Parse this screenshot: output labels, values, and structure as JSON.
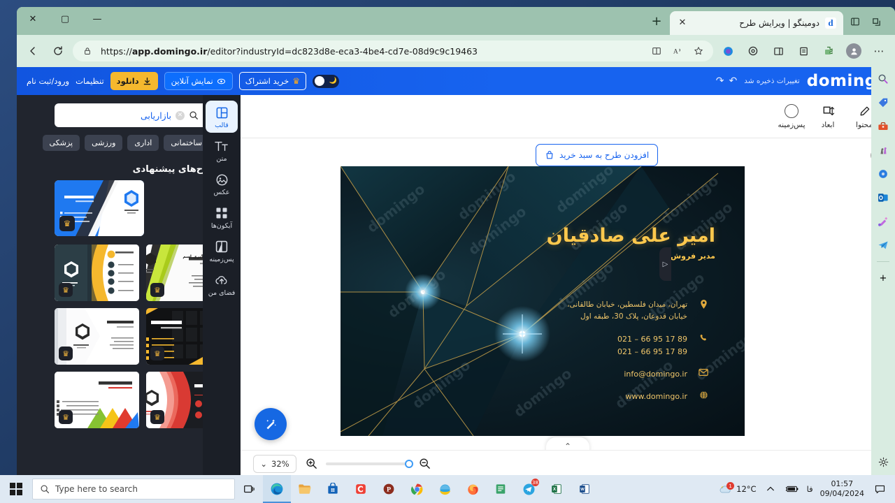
{
  "browser": {
    "tab": {
      "title": "دومینگو | ویرایش طرح",
      "favicon_letter": "d"
    },
    "new_tab_label": "+",
    "url_prefix": "https://",
    "url_domain": "app.domingo.ir",
    "url_path": "/editor?industryId=dc823d8e-eca3-4be4-cd7e-08d9c9c19463",
    "window_controls": {
      "minimize": "—",
      "maximize": "▢",
      "close": "✕"
    }
  },
  "app_header": {
    "logo": "domingo",
    "saved_text": "تغییرات ذخیره شد",
    "undo": "↶",
    "redo": "↷",
    "buy_subscription": "خرید اشتراک",
    "online_preview": "نمایش آنلاین",
    "download": "دانلود",
    "settings": "تنظیمات",
    "login_register": "ورود/ثبت نام",
    "accent_blue": "#1763ef",
    "accent_yellow": "#f5b82e"
  },
  "canvas_toolbar": {
    "items": [
      {
        "label": "محتوا",
        "icon": "pencil-icon"
      },
      {
        "label": "ابعاد",
        "icon": "resize-icon"
      },
      {
        "label": "پس‌زمینه",
        "icon": "circle-icon"
      }
    ]
  },
  "canvas": {
    "add_to_cart": "افزودن طرح به سبد خرید",
    "info_tooltip": "i",
    "zoom_level": "32%",
    "collapse_caret": "⌃"
  },
  "business_card": {
    "name": "امیر علی صادقیان",
    "role": "مدیر فروش",
    "watermark": "domingo",
    "contacts": [
      {
        "icon": "location-icon",
        "line1": "تهران، میدان فلسطین، خیابان طالقانی،",
        "line2": "خیابان قدوعان، پلاک 30، طبقه اول"
      },
      {
        "icon": "phone-icon",
        "line1": "021 – 66 95 17 89",
        "line2": "021 – 66 95 17 89"
      },
      {
        "icon": "mail-icon",
        "line1": "info@domingo.ir",
        "line2": ""
      },
      {
        "icon": "globe-icon",
        "line1": "www.domingo.ir",
        "line2": ""
      }
    ]
  },
  "panel": {
    "search_value": "بازاریابی",
    "search_clear": "✕",
    "filter_icon": "filter-icon",
    "chips": [
      "پزشکی",
      "ورزشی",
      "اداری",
      "ساختمانی"
    ],
    "chips_prev": "‹",
    "section_title": "طرح‌های پیشنهادی",
    "featured_card": {
      "name": "امیر علی صادقیان",
      "role": "مدیر فروش",
      "brand": "انرژی محصول"
    },
    "templates": [
      {
        "placeholder_name": "محل قرار گیری اسم",
        "placeholder_role": "محل قرارگیری سمت",
        "style": "white-green"
      },
      {
        "placeholder_name": "محل قرار گیری اسم",
        "placeholder_role": "محل قرارگیری سمت",
        "style": "dark-yellow"
      },
      {
        "placeholder_name": "محل قرار گیری اسم",
        "placeholder_role": "محل قرارگیری سمت",
        "style": "black-yellow"
      },
      {
        "placeholder_name": "محل قرار گیری اسم",
        "placeholder_role": "محل قرارگیری سمت",
        "style": "white-grey"
      },
      {
        "placeholder_name": "محل قرار گیری اسم",
        "placeholder_role": "محل قرارگیری سمت",
        "style": "dark-red"
      },
      {
        "placeholder_name": "محل قرار گیری اسم",
        "placeholder_role": "محل قرارگیری سمت",
        "style": "white-color"
      }
    ],
    "collapse_arrow": "▷"
  },
  "rail": {
    "items": [
      {
        "label": "قالب",
        "icon": "template-icon",
        "active": true
      },
      {
        "label": "متن",
        "icon": "text-icon",
        "active": false
      },
      {
        "label": "عکس",
        "icon": "image-icon",
        "active": false
      },
      {
        "label": "آیکون‌ها",
        "icon": "icons-grid-icon",
        "active": false
      },
      {
        "label": "پس‌زمینه",
        "icon": "background-icon",
        "active": false
      },
      {
        "label": "فضای من",
        "icon": "cloud-upload-icon",
        "active": false
      }
    ]
  },
  "edge_sidebar": {
    "items": [
      {
        "icon": "search-icon"
      },
      {
        "icon": "shopping-tag-icon"
      },
      {
        "icon": "toolbox-icon"
      },
      {
        "icon": "games-icon"
      },
      {
        "icon": "copilot-icon"
      },
      {
        "icon": "outlook-icon"
      },
      {
        "icon": "image-creator-icon"
      },
      {
        "icon": "telegram-icon"
      }
    ],
    "add_label": "+",
    "settings_icon": "gear-icon"
  },
  "taskbar": {
    "search_placeholder": "Type here to search",
    "weather_temp": "12°C",
    "language": "فا",
    "clock_time": "01:57",
    "clock_date": "09/04/2024",
    "notification_count": "1",
    "apps": [
      {
        "name": "task-view"
      },
      {
        "name": "edge",
        "active": true
      },
      {
        "name": "file-explorer"
      },
      {
        "name": "microsoft-store"
      },
      {
        "name": "camtasia"
      },
      {
        "name": "photoshop-like"
      },
      {
        "name": "chrome"
      },
      {
        "name": "internet-explorer"
      },
      {
        "name": "firefox"
      },
      {
        "name": "notepad"
      },
      {
        "name": "telegram"
      },
      {
        "name": "excel"
      },
      {
        "name": "word"
      }
    ]
  }
}
